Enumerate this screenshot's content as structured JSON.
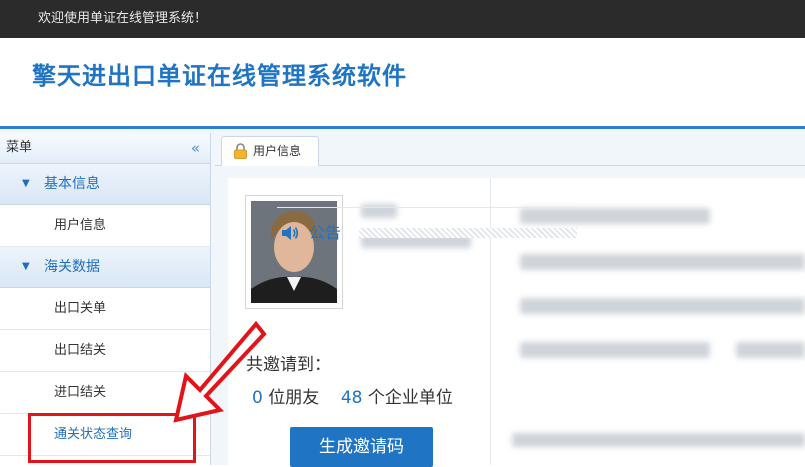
{
  "topbar": {
    "welcome": "欢迎使用单证在线管理系统！"
  },
  "header": {
    "title": "擎天进出口单证在线管理系统软件"
  },
  "sidebar": {
    "title": "菜单",
    "groups": [
      {
        "label": "基本信息",
        "items": [
          {
            "label": "用户信息"
          }
        ]
      },
      {
        "label": "海关数据",
        "items": [
          {
            "label": "出口关单"
          },
          {
            "label": "出口结关"
          },
          {
            "label": "进口结关"
          },
          {
            "label": "通关状态查询"
          }
        ]
      }
    ]
  },
  "tabs": [
    {
      "label": "用户信息"
    }
  ],
  "profile": {
    "invite_title": "共邀请到：",
    "friends_count": "0",
    "friends_label": "位朋友",
    "companies_count": "48",
    "companies_label": "个企业单位",
    "generate_button": "生成邀请码"
  },
  "notice": {
    "label": "公告"
  },
  "colors": {
    "accent": "#1f74c4",
    "highlight": "#e1141a",
    "topbar": "#2b2b2b"
  }
}
